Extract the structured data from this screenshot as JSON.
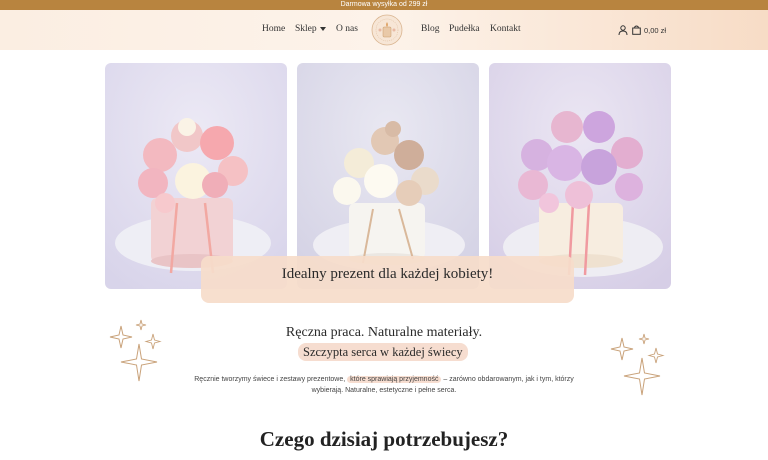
{
  "topbar": {
    "text": "Darmowa wysyłka od 299 zł"
  },
  "nav": {
    "items": [
      {
        "label": "Home"
      },
      {
        "label": "Sklep"
      },
      {
        "label": "O nas"
      },
      {
        "label": "Blog"
      },
      {
        "label": "Pudełka"
      },
      {
        "label": "Kontakt"
      }
    ],
    "cart_total": "0,00 zł",
    "icons": [
      "user-icon",
      "shopping-bag-icon",
      "chevron-down-icon"
    ]
  },
  "hero": {
    "banner_text": "Idealny prezent dla każdej kobiety!"
  },
  "intro": {
    "headline": "Ręczna praca. Naturalne materiały.",
    "subheadline": "Szczypta serca w każdej świecy",
    "para_before": "Ręcznie tworzymy świece i zestawy prezentowe,",
    "para_highlight": "które sprawiają przyjemność",
    "para_after": "– zarówno obdarowanym, jak i tym, którzy wybierają. Naturalne, estetyczne i pełne serca."
  },
  "section": {
    "title": "Czego dzisiaj potrzebujesz?"
  },
  "colors": {
    "topbar": "#b8843f",
    "header_bg": "#fdf3ea",
    "banner": "#f6ddd0",
    "sparkle": "#c9a27a"
  }
}
